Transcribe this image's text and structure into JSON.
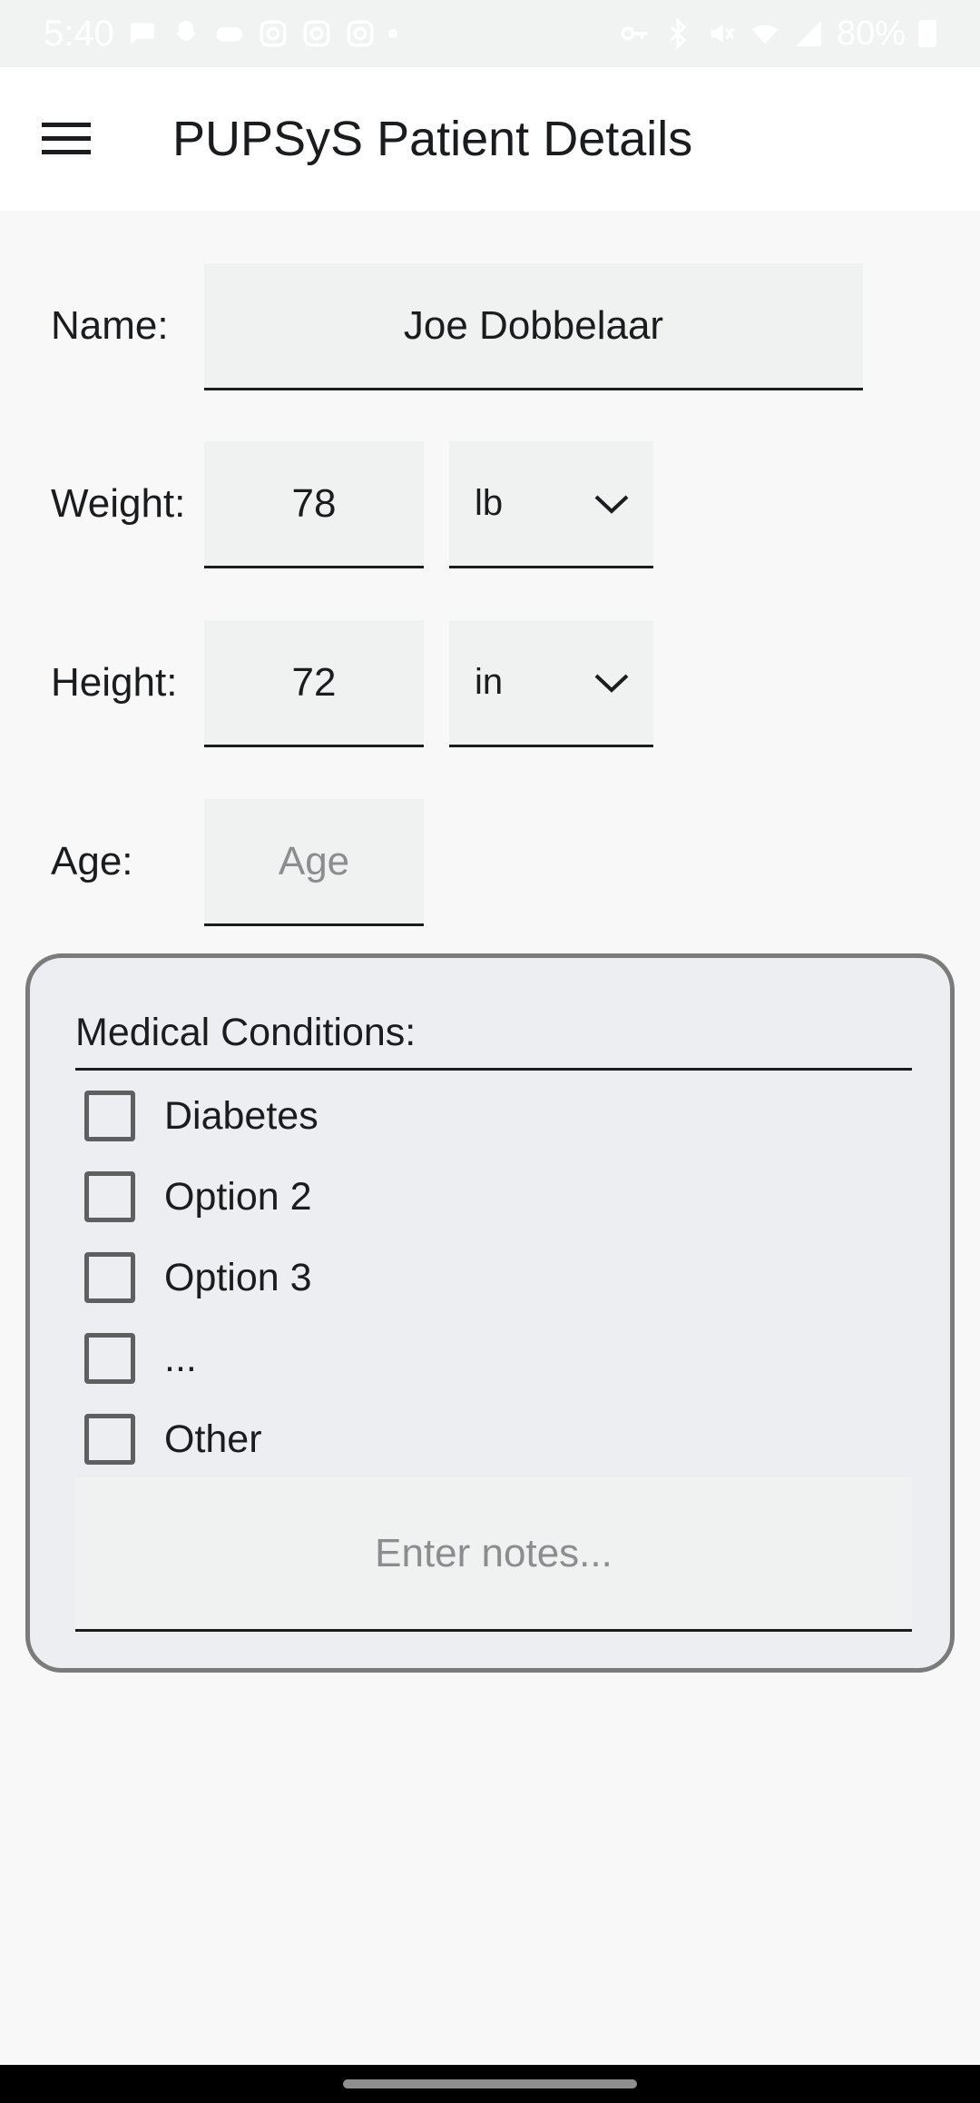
{
  "status_bar": {
    "time": "5:40",
    "battery": "80%"
  },
  "app_bar": {
    "title": "PUPSyS Patient Details",
    "menu_icon": "menu-icon"
  },
  "form": {
    "name": {
      "label": "Name:",
      "value": "Joe Dobbelaar"
    },
    "weight": {
      "label": "Weight:",
      "value": "78",
      "unit": "lb"
    },
    "height": {
      "label": "Height:",
      "value": "72",
      "unit": "in"
    },
    "age": {
      "label": "Age:",
      "value": "",
      "placeholder": "Age"
    }
  },
  "conditions": {
    "title": "Medical Conditions:",
    "items": [
      {
        "label": "Diabetes",
        "checked": false
      },
      {
        "label": "Option 2",
        "checked": false
      },
      {
        "label": "Option 3",
        "checked": false
      },
      {
        "label": "...",
        "checked": false
      },
      {
        "label": "Other",
        "checked": false
      }
    ],
    "notes_placeholder": "Enter notes..."
  }
}
